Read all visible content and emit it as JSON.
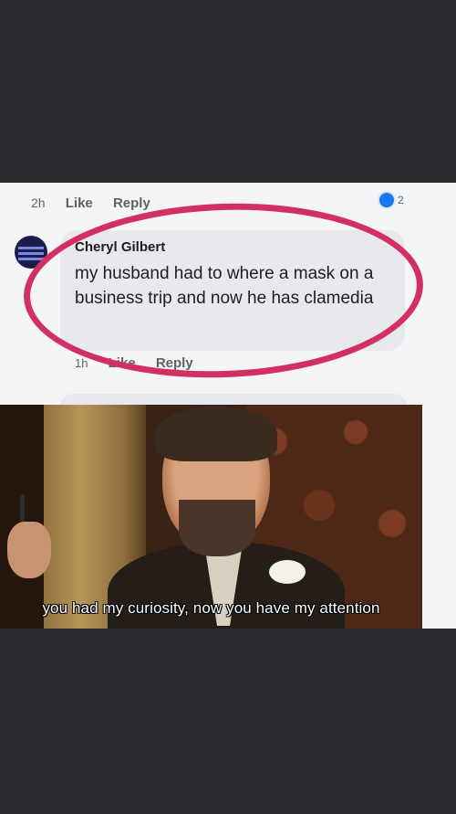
{
  "comment_top": {
    "time": "2h",
    "like_label": "Like",
    "reply_label": "Reply",
    "reaction_count": "2",
    "reaction_icon": "like-reaction-icon"
  },
  "comment": {
    "author": "Cheryl Gilbert",
    "text": "my husband had to where a mask on a business trip and now he has clamedia",
    "time": "1h",
    "like_label": "Like",
    "reply_label": "Reply"
  },
  "meme": {
    "caption": "you had my curiosity, now you have my attention"
  },
  "colors": {
    "highlight": "#d22f63",
    "background": "#2b2c30",
    "panel": "#f4f5f7"
  }
}
